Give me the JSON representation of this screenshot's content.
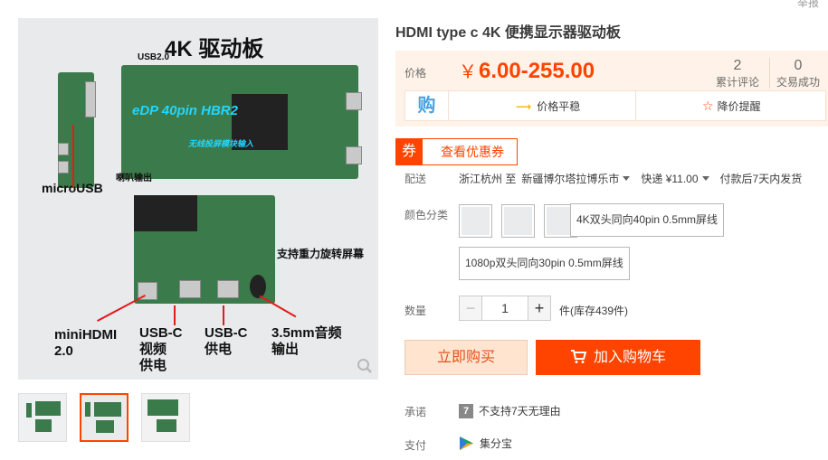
{
  "top_right_link": "举报",
  "gallery": {
    "main_image_text": {
      "title": "4K 驱动板",
      "usb2": "USB2.0",
      "edp": "eDP 40pin HBR2",
      "touch": "无线投屏模块输入",
      "speaker": "喇叭输出",
      "microusb": "microUSB",
      "gravity": "支持重力旋转屏幕",
      "minihdmi": "miniHDMI\n2.0",
      "usbc_video": "USB-C\n视频\n供电",
      "usbc_power": "USB-C\n供电",
      "audio": "3.5mm音频\n输出"
    },
    "thumbnails": 3,
    "active_thumbnail": 2
  },
  "product": {
    "title": "HDMI type c 4K 便携显示器驱动板",
    "price_label": "价格",
    "price_currency": "￥",
    "price_range": "6.00-255.00",
    "reviews_count": "2",
    "reviews_label": "累计评论",
    "sales_count": "0",
    "sales_label": "交易成功",
    "promo_icon": "购",
    "price_stable": "价格平稳",
    "price_alert": "降价提醒",
    "coupon_tag": "券",
    "coupon_text": "查看优惠券"
  },
  "shipping": {
    "label": "配送",
    "from": "浙江杭州 至",
    "to": "新疆博尔塔拉博乐市",
    "express": "快递 ¥11.00",
    "promise": "付款后7天内发货"
  },
  "sku": {
    "label": "颜色分类",
    "option_text_1": "4K双头同向40pin 0.5mm屏线",
    "option_text_2": "1080p双头同向30pin 0.5mm屏线"
  },
  "quantity": {
    "label": "数量",
    "value": "1",
    "minus": "−",
    "plus": "+",
    "stock": "件(库存439件)"
  },
  "actions": {
    "buy_now": "立即购买",
    "add_to_cart": "加入购物车"
  },
  "service": {
    "commit_label": "承诺",
    "commit_badge": "7",
    "commit_text": "不支持7天无理由",
    "pay_label": "支付",
    "pay_text": "集分宝"
  },
  "colors": {
    "accent": "#ff4400",
    "price_bg": "#fff2e8"
  }
}
